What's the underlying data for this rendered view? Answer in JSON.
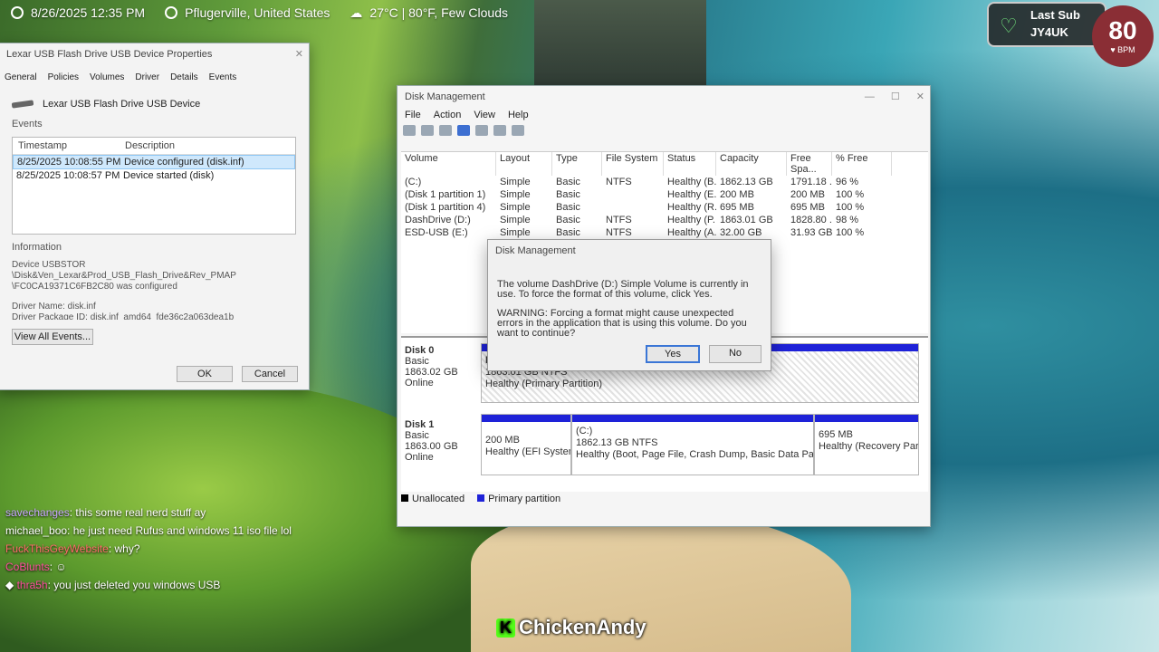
{
  "topbar": {
    "datetime": "8/26/2025 12:35 PM",
    "location": "Pflugerville, United States",
    "weather": "27°C | 80°F, Few Clouds"
  },
  "sub_widget": {
    "title": "Last Sub",
    "name": "JY4UK"
  },
  "heart_rate": {
    "value": "80",
    "unit": "♥ BPM"
  },
  "props": {
    "title": "Lexar USB Flash Drive USB Device Properties",
    "tabs": [
      "General",
      "Policies",
      "Volumes",
      "Driver",
      "Details",
      "Events"
    ],
    "device": "Lexar USB Flash Drive USB Device",
    "events_label": "Events",
    "col_timestamp": "Timestamp",
    "col_description": "Description",
    "events": [
      {
        "ts": "8/25/2025 10:08:55 PM",
        "desc": "Device configured (disk.inf)"
      },
      {
        "ts": "8/25/2025 10:08:57 PM",
        "desc": "Device started (disk)"
      }
    ],
    "info_label": "Information",
    "info_lines": [
      "Device USBSTOR",
      "\\Disk&Ven_Lexar&Prod_USB_Flash_Drive&Rev_PMAP",
      "\\FC0CA19371C6FB2C80 was configured",
      "",
      "Driver Name: disk.inf",
      "Driver Package ID: disk.inf_amd64_fde36c2a063dea1b"
    ],
    "view_all": "View All Events...",
    "ok": "OK",
    "cancel": "Cancel"
  },
  "dm": {
    "title": "Disk Management",
    "menu": [
      "File",
      "Action",
      "View",
      "Help"
    ],
    "columns": [
      "Volume",
      "Layout",
      "Type",
      "File System",
      "Status",
      "Capacity",
      "Free Spa...",
      "% Free"
    ],
    "rows": [
      [
        "(C:)",
        "Simple",
        "Basic",
        "NTFS",
        "Healthy (B...",
        "1862.13 GB",
        "1791.18 ...",
        "96 %"
      ],
      [
        "(Disk 1 partition 1)",
        "Simple",
        "Basic",
        "",
        "Healthy (E...",
        "200 MB",
        "200 MB",
        "100 %"
      ],
      [
        "(Disk 1 partition 4)",
        "Simple",
        "Basic",
        "",
        "Healthy (R...",
        "695 MB",
        "695 MB",
        "100 %"
      ],
      [
        "DashDrive (D:)",
        "Simple",
        "Basic",
        "NTFS",
        "Healthy (P...",
        "1863.01 GB",
        "1828.80 ...",
        "98 %"
      ],
      [
        "ESD-USB (E:)",
        "Simple",
        "Basic",
        "NTFS",
        "Healthy (A...",
        "32.00 GB",
        "31.93 GB",
        "100 %"
      ]
    ],
    "disk0": {
      "name": "Disk 0",
      "type": "Basic",
      "size": "1863.02 GB",
      "state": "Online",
      "part_name": "D",
      "part_size": "1863.01 GB NTFS",
      "part_status": "Healthy (Primary Partition)"
    },
    "disk1": {
      "name": "Disk 1",
      "type": "Basic",
      "size": "1863.00 GB",
      "state": "Online",
      "p1_size": "200 MB",
      "p1_status": "Healthy (EFI System I",
      "p2_name": "(C:)",
      "p2_size": "1862.13 GB NTFS",
      "p2_status": "Healthy (Boot, Page File, Crash Dump, Basic Data Partition)",
      "p3_size": "695 MB",
      "p3_status": "Healthy (Recovery Partitio"
    },
    "legend_unalloc": "Unallocated",
    "legend_primary": "Primary partition"
  },
  "dialog": {
    "title": "Disk Management",
    "msg1": "The volume DashDrive (D:) Simple Volume is currently in use. To force the format of this volume, click Yes.",
    "msg2": "WARNING: Forcing a format might cause unexpected errors in the application that is using this volume. Do you want to continue?",
    "yes": "Yes",
    "no": "No"
  },
  "chat": [
    {
      "user": "savechanges",
      "msg": "this some real nerd stuff ay"
    },
    {
      "user": "michael_boo",
      "msg": "he just need Rufus and windows 11 iso file lol"
    },
    {
      "user": "FuckThisGeyWebsite",
      "msg": "why?"
    },
    {
      "user": "CoBlunts",
      "msg": ""
    },
    {
      "user": "thra5h",
      "msg": "you just deleted you windows USB"
    }
  ],
  "brand": {
    "badge": "K",
    "name": "ChickenAndy"
  },
  "colors": {
    "primary_partition": "#1e22d8",
    "selection": "#cfe8fc"
  }
}
